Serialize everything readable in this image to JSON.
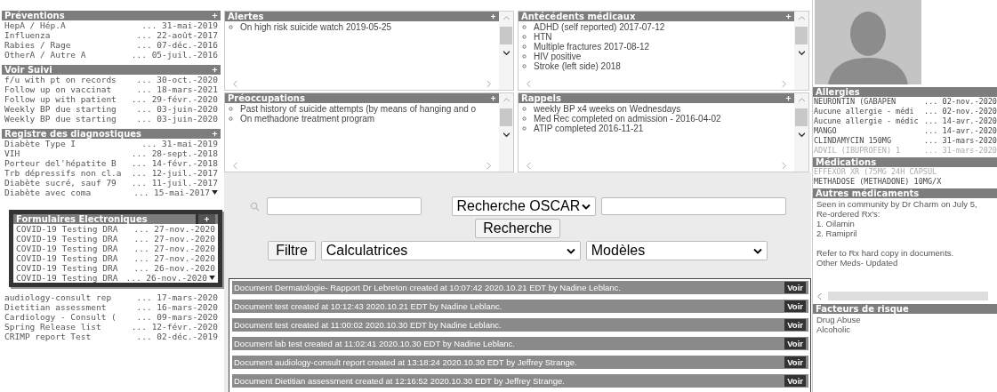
{
  "left_sections": [
    {
      "title": "Préventions",
      "highlighted": false,
      "rows": [
        {
          "label": "HepA / Hép.A",
          "date": "... 31-mai-2019",
          "more": false
        },
        {
          "label": "Influenza",
          "date": "... 22-août-2017",
          "more": false
        },
        {
          "label": "Rabies / Rage",
          "date": "... 07-déc.-2016",
          "more": false
        },
        {
          "label": "OtherA / Autre A",
          "date": "... 05-juil.-2016",
          "more": false
        }
      ]
    },
    {
      "title": "Voir Suivi",
      "highlighted": false,
      "rows": [
        {
          "label": "f/u with pt on records",
          "date": "... 30-oct.-2020",
          "more": false
        },
        {
          "label": "Follow up on vaccinat",
          "date": "... 18-mars-2021",
          "more": false
        },
        {
          "label": "Follow up with patient",
          "date": "... 29-févr.-2020",
          "more": false
        },
        {
          "label": "Weekly BP due starting",
          "date": "... 03-juin-2020",
          "more": false
        },
        {
          "label": "Weekly BP due starting",
          "date": "... 03-juin-2020",
          "more": false
        }
      ]
    },
    {
      "title": "Registre des diagnostiques",
      "highlighted": false,
      "rows": [
        {
          "label": "Diabète Type I",
          "date": "... 31-mai-2019",
          "more": false
        },
        {
          "label": "VIH",
          "date": "... 28-sept.-2018",
          "more": false
        },
        {
          "label": "Porteur del'hépatite B",
          "date": "... 14-févr.-2018",
          "more": false
        },
        {
          "label": "Trb dépressifs non cl.a",
          "date": "... 12-juil.-2017",
          "more": false
        },
        {
          "label": "Diabète sucré, sauf 79",
          "date": "... 11-juil.-2017",
          "more": false
        },
        {
          "label": "Diabète avec coma",
          "date": "... 15-mai-2017",
          "more": true
        }
      ]
    },
    {
      "title": "Formulaires Electroniques",
      "highlighted": true,
      "rows": [
        {
          "label": "COVID-19 Testing DRA",
          "date": "... 27-nov.-2020",
          "more": false
        },
        {
          "label": "COVID-19 Testing DRA",
          "date": "... 27-nov.-2020",
          "more": false
        },
        {
          "label": "COVID-19 Testing DRA",
          "date": "... 27-nov.-2020",
          "more": false
        },
        {
          "label": "COVID-19 Testing DRA",
          "date": "... 27-nov.-2020",
          "more": false
        },
        {
          "label": "COVID-19 Testing DRA",
          "date": "... 26-nov.-2020",
          "more": false
        },
        {
          "label": "COVID-19 Testing DRA",
          "date": "... 26-nov.-2020",
          "more": true
        }
      ]
    },
    {
      "highlighted": false,
      "rows": [
        {
          "label": "audiology-consult rep",
          "date": "... 17-mars-2020",
          "more": false
        },
        {
          "label": "Dietitian assessment",
          "date": "... 16-mars-2020",
          "more": false
        },
        {
          "label": "Cardiology - Consult (",
          "date": "... 09-mars-2020",
          "more": false
        },
        {
          "label": "Spring Release list",
          "date": "... 12-févr.-2020",
          "more": false
        },
        {
          "label": "CRIMP report Test",
          "date": "... 02-déc.-2019",
          "more": false
        }
      ]
    }
  ],
  "panels": [
    {
      "title": "Alertes",
      "items": [
        "On high risk suicide watch 2019-05-25"
      ]
    },
    {
      "title": "Antécédents médicaux",
      "items": [
        "ADHD (self reported) 2017-07-12",
        "HTN",
        "Multiple fractures 2017-08-12",
        "HIV positive",
        "Stroke (left side) 2018"
      ]
    },
    {
      "title": "Préoccupations",
      "items": [
        "Past history of suicide attempts (by means of hanging and o",
        "On methadone treatment program"
      ]
    },
    {
      "title": "Rappels",
      "items": [
        "weekly BP x4 weeks on Wednesdays",
        "Med Rec completed on admission - 2016-04-02",
        "ATIP completed 2016-11-21"
      ]
    }
  ],
  "search": {
    "scope": "Recherche OSCAR",
    "search_button": "Recherche",
    "filter_button": "Filtre",
    "calculators": "Calculatrices",
    "templates": "Modèles"
  },
  "documents": [
    {
      "text": "Document Dermatologie- Rapport Dr Lebreton created at 10:07:42 2020.10.21 EDT by Nadine Leblanc.",
      "button": "Voir"
    },
    {
      "text": "Document test created at 10:12:43 2020.10.21 EDT by Nadine Leblanc.",
      "button": "Voir"
    },
    {
      "text": "Document test created at 11:00:02 2020.10.30 EDT by Nadine Leblanc.",
      "button": "Voir"
    },
    {
      "text": "Document lab test created at 11:02:41 2020.10.30 EDT by Nadine Leblanc.",
      "button": "Voir"
    },
    {
      "text": "Document audiology-consult report created at 13:18:24 2020.10.30 EDT by Jeffrey Strange.",
      "button": "Voir"
    },
    {
      "text": "Document Dietitian assessment created at 12:16:52 2020.10.30 EDT by Jeffrey Strange.",
      "button": "Voir"
    }
  ],
  "allergies": {
    "title": "Allergies",
    "rows": [
      {
        "label": "NEURONTIN (GABAPEN",
        "date": "... 02-nov.-2020",
        "faded": false
      },
      {
        "label": "Aucune allergie - médi",
        "date": "... 02-nov.-2020",
        "faded": false
      },
      {
        "label": "Aucune allergie - médic",
        "date": "... 14-avr.-2020",
        "faded": false
      },
      {
        "label": "MANGO",
        "date": "... 14-avr.-2020",
        "faded": false
      },
      {
        "label": "CLINDAMYCIN 150MG",
        "date": "... 31-mars-2020",
        "faded": false
      },
      {
        "label": "ADVIL (IBUPROFEN) 1",
        "date": "... 31-mars-2020",
        "faded": true
      }
    ]
  },
  "medications": {
    "title": "Médications",
    "rows": [
      {
        "label": "EFFEXOR XR (75MG 24H CAPSUL",
        "faded": true
      },
      {
        "label": "METHADOSE (METHADONE) 10MG/X",
        "faded": false
      }
    ]
  },
  "other_meds": {
    "title": "Autres médicaments",
    "paragraphs": [
      [
        "Seen in community by Dr Charm on July 5,",
        "Re-ordered Rx's:",
        "1. Oilamin",
        "2. Ramipril"
      ],
      [
        "Refer to Rx hard copy in documents.",
        "Other Meds- Updated"
      ]
    ]
  },
  "risk_factors": {
    "title": "Facteurs de risque",
    "lines": [
      "Drug Abuse",
      "Alcoholic"
    ]
  }
}
